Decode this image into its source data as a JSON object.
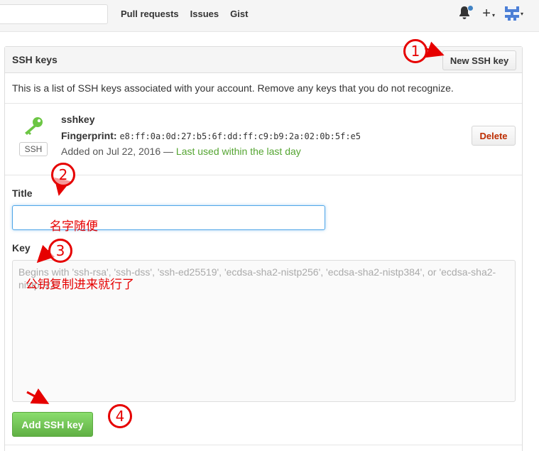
{
  "header": {
    "nav": [
      "Pull requests",
      "Issues",
      "Gist"
    ],
    "plus": "+",
    "caret": "▾"
  },
  "panel": {
    "title": "SSH keys",
    "new_button": "New SSH key",
    "info": "This is a list of SSH keys associated with your account. Remove any keys that you do not recognize."
  },
  "key": {
    "badge": "SSH",
    "name": "sshkey",
    "fingerprint_label": "Fingerprint:",
    "fingerprint": "e8:ff:0a:0d:27:b5:6f:dd:ff:c9:b9:2a:02:0b:5f:e5",
    "added": "Added on Jul 22, 2016 —",
    "last_used": "Last used within the last day",
    "delete_button": "Delete"
  },
  "form": {
    "title_label": "Title",
    "title_value": "",
    "key_label": "Key",
    "key_placeholder": "Begins with 'ssh-rsa', 'ssh-dss', 'ssh-ed25519', 'ecdsa-sha2-nistp256', 'ecdsa-sha2-nistp384', or 'ecdsa-sha2-nistp521'",
    "add_button": "Add SSH key"
  },
  "annotations": {
    "step1": "1",
    "step2": "2",
    "step3": "3",
    "step4": "4",
    "note_title": "名字随便",
    "note_key": "公钥复制进来就行了"
  },
  "colors": {
    "accent": "#4183c4",
    "success": "#55a532",
    "danger": "#bd2c00",
    "annotation": "#e60000"
  }
}
